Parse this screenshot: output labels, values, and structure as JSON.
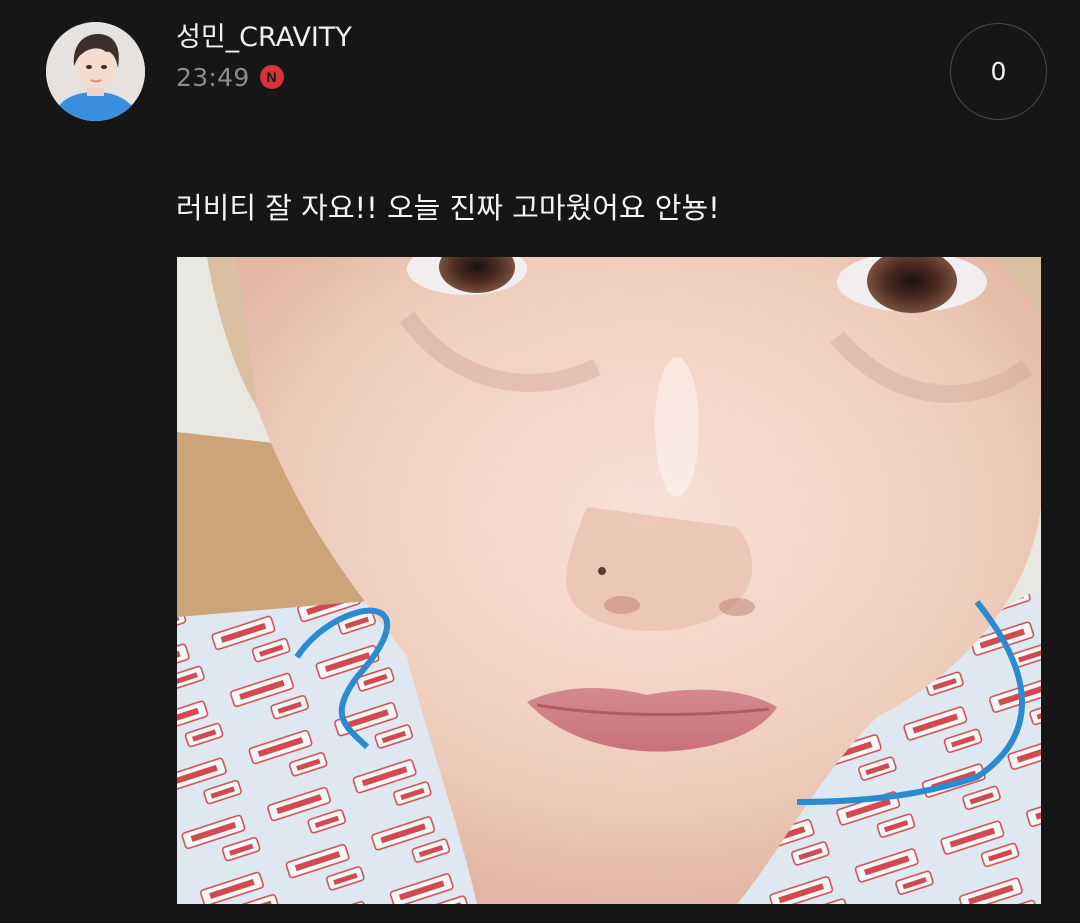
{
  "post": {
    "author": {
      "name": "성민_CRAVITY",
      "avatar_icon": "profile-photo"
    },
    "time": "23:49",
    "new_badge": "N",
    "comment_count": "0",
    "text": "러비티 잘 자요!! 오늘 진짜 고마웠어요 안뇽!",
    "photo_icon": "selfie-photo"
  },
  "colors": {
    "background": "#161616",
    "badge": "#d6343a",
    "meta_text": "#8c8c8c"
  }
}
